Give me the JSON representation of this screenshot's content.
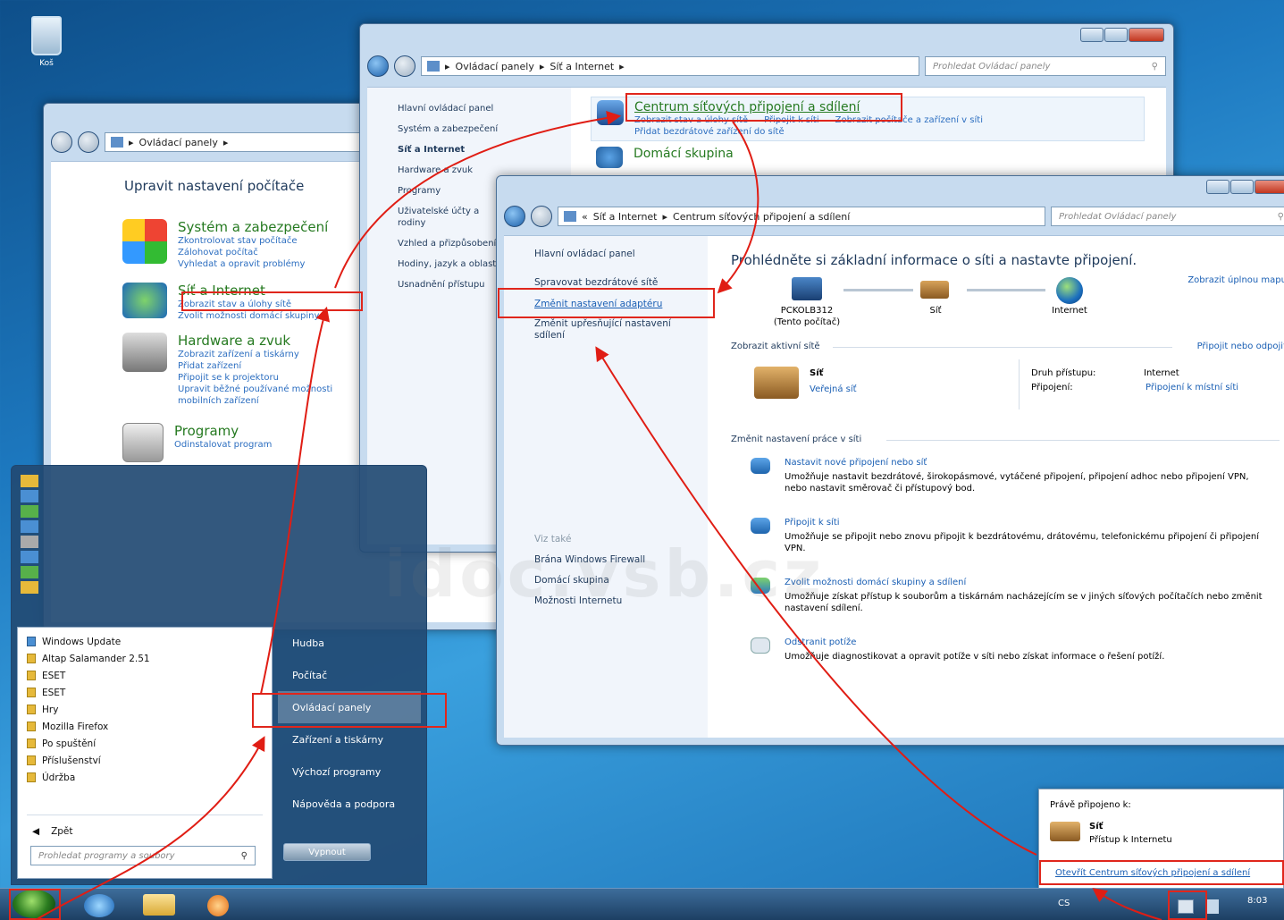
{
  "desktop": {
    "recycle_label": "Koš"
  },
  "win1": {
    "address": [
      "Ovládací panely"
    ],
    "heading": "Upravit nastavení počítače",
    "categories": [
      {
        "title": "Systém a zabezpečení",
        "links": [
          "Zkontrolovat stav počítače",
          "Zálohovat počítač",
          "Vyhledat a opravit problémy"
        ]
      },
      {
        "title": "Síť a Internet",
        "links": [
          "Zobrazit stav a úlohy sítě",
          "Zvolit možnosti domácí skupiny"
        ]
      },
      {
        "title": "Hardware a zvuk",
        "links": [
          "Zobrazit zařízení a tiskárny",
          "Přidat zařízení",
          "Připojit se k projektoru",
          "Upravit běžné používané možnosti mobilních zařízení"
        ]
      },
      {
        "title": "Programy",
        "links": [
          "Odinstalovat program"
        ]
      }
    ]
  },
  "win2": {
    "address": [
      "Ovládací panely",
      "Síť a Internet"
    ],
    "search_placeholder": "Prohledat Ovládací panely",
    "side": [
      "Hlavní ovládací panel",
      "Systém a zabezpečení",
      "Síť a Internet",
      "Hardware a zvuk",
      "Programy",
      "Uživatelské účty a rodiny",
      "Vzhled a přizpůsobení",
      "Hodiny, jazyk a oblast",
      "Usnadnění přístupu"
    ],
    "items": [
      {
        "title": "Centrum síťových připojení a sdílení",
        "links": [
          "Zobrazit stav a úlohy sítě",
          "Připojit k síti",
          "Zobrazit počítače a zařízení v síti",
          "Přidat bezdrátové zařízení do sítě"
        ]
      },
      {
        "title": "Domácí skupina",
        "links": []
      }
    ]
  },
  "win3": {
    "address": [
      "Síť a Internet",
      "Centrum síťových připojení a sdílení"
    ],
    "search_placeholder": "Prohledat Ovládací panely",
    "side": [
      "Hlavní ovládací panel",
      "Spravovat bezdrátové sítě",
      "Změnit nastavení adaptéru",
      "Změnit upřesňující nastavení sdílení"
    ],
    "see_also_title": "Viz také",
    "see_also": [
      "Brána Windows Firewall",
      "Domácí skupina",
      "Možnosti Internetu"
    ],
    "heading": "Prohlédněte si základní informace o síti a nastavte připojení.",
    "full_map": "Zobrazit úplnou mapu",
    "map": {
      "pc": "PCKOLB312",
      "pc_sub": "(Tento počítač)",
      "net": "Síť",
      "internet": "Internet"
    },
    "active_title": "Zobrazit aktivní sítě",
    "connect_link": "Připojit nebo odpojit",
    "net_name": "Síť",
    "net_type": "Veřejná síť",
    "access_label": "Druh přístupu:",
    "access_value": "Internet",
    "conn_label": "Připojení:",
    "conn_value": "Připojení k místní síti",
    "change_title": "Změnit nastavení práce v síti",
    "tasks": [
      {
        "title": "Nastavit nové připojení nebo síť",
        "desc": "Umožňuje nastavit bezdrátové, širokopásmové, vytáčené připojení, připojení adhoc nebo připojení VPN, nebo nastavit směrovač či přístupový bod."
      },
      {
        "title": "Připojit k síti",
        "desc": "Umožňuje se připojit nebo znovu připojit k bezdrátovému, drátovému, telefonickému připojení či připojení VPN."
      },
      {
        "title": "Zvolit možnosti domácí skupiny a sdílení",
        "desc": "Umožňuje získat přístup k souborům a tiskárnám nacházejícím se v jiných síťových počítačích nebo změnit nastavení sdílení."
      },
      {
        "title": "Odstranit potíže",
        "desc": "Umožňuje diagnostikovat a opravit potíže v síti nebo získat informace o řešení potíží."
      }
    ]
  },
  "startmenu": {
    "programs": [
      "Windows Update",
      "Altap Salamander 2.51",
      "ESET",
      "ESET",
      "Hry",
      "Mozilla Firefox",
      "Po spuštění",
      "Příslušenství",
      "Údržba"
    ],
    "back": "Zpět",
    "search_placeholder": "Prohledat programy a soubory",
    "right": [
      "Hudba",
      "Počítač",
      "Ovládací panely",
      "Zařízení a tiskárny",
      "Výchozí programy",
      "Nápověda a podpora"
    ],
    "shutdown": "Vypnout"
  },
  "tray_popup": {
    "title": "Právě připojeno k:",
    "net": "Síť",
    "access": "Přístup k Internetu",
    "link": "Otevřít Centrum síťových připojení a sdílení"
  },
  "taskbar": {
    "lang": "CS",
    "time": "8:03"
  },
  "watermark": "idoc.vsb.cz"
}
